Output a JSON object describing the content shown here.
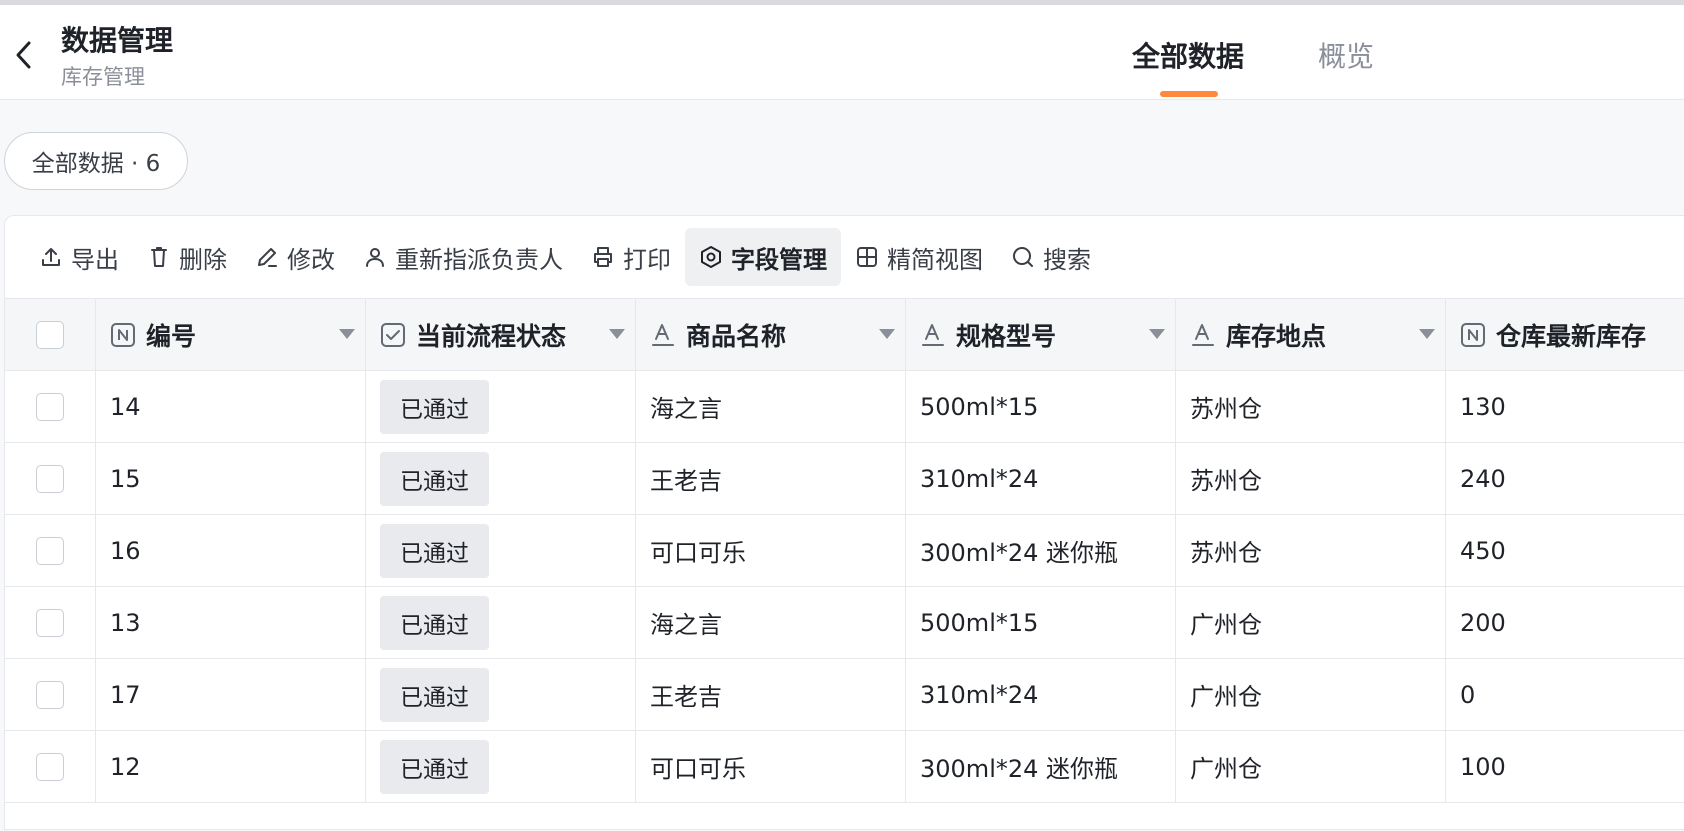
{
  "header": {
    "title": "数据管理",
    "subtitle": "库存管理",
    "tabs": [
      {
        "label": "全部数据",
        "active": true
      },
      {
        "label": "概览",
        "active": false
      }
    ],
    "accent_color": "#ff8a3d"
  },
  "view_chip": {
    "label": "全部数据 · 6"
  },
  "toolbar": {
    "export": "导出",
    "delete": "删除",
    "edit": "修改",
    "reassign": "重新指派负责人",
    "print": "打印",
    "field_manage": "字段管理",
    "compact_view": "精简视图",
    "search": "搜索"
  },
  "table": {
    "columns": [
      {
        "label": "编号",
        "icon": "number-field-icon"
      },
      {
        "label": "当前流程状态",
        "icon": "checkbox-field-icon"
      },
      {
        "label": "商品名称",
        "icon": "text-field-icon"
      },
      {
        "label": "规格型号",
        "icon": "text-field-icon"
      },
      {
        "label": "库存地点",
        "icon": "text-field-icon"
      },
      {
        "label": "仓库最新库存",
        "icon": "number-field-icon"
      }
    ],
    "rows": [
      {
        "id": "14",
        "status": "已通过",
        "name": "海之言",
        "spec": "500ml*15",
        "location": "苏州仓",
        "stock": "130"
      },
      {
        "id": "15",
        "status": "已通过",
        "name": "王老吉",
        "spec": "310ml*24",
        "location": "苏州仓",
        "stock": "240"
      },
      {
        "id": "16",
        "status": "已通过",
        "name": "可口可乐",
        "spec": "300ml*24 迷你瓶",
        "location": "苏州仓",
        "stock": "450"
      },
      {
        "id": "13",
        "status": "已通过",
        "name": "海之言",
        "spec": "500ml*15",
        "location": "广州仓",
        "stock": "200"
      },
      {
        "id": "17",
        "status": "已通过",
        "name": "王老吉",
        "spec": "310ml*24",
        "location": "广州仓",
        "stock": "0"
      },
      {
        "id": "12",
        "status": "已通过",
        "name": "可口可乐",
        "spec": "300ml*24 迷你瓶",
        "location": "广州仓",
        "stock": "100"
      }
    ]
  }
}
